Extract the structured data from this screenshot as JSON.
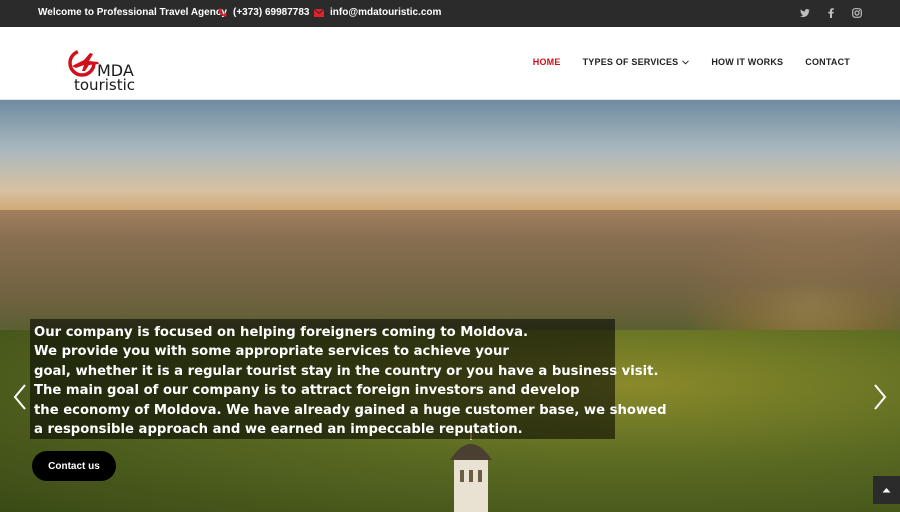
{
  "topbar": {
    "welcome": "Welcome to Professional Travel Agency",
    "phone": "(+373) 69987783",
    "email": "info@mdatouristic.com",
    "social": [
      "twitter-icon",
      "facebook-icon",
      "instagram-icon"
    ]
  },
  "brand": {
    "name_line1": "MDA",
    "name_line2": "touristic",
    "accent_color": "#d0101a"
  },
  "nav": {
    "home": "HOME",
    "services": "TYPES OF SERVICES",
    "how": "HOW IT WORKS",
    "contact": "CONTACT"
  },
  "hero": {
    "lines": [
      "Our company is focused on helping foreigners coming to Moldova.",
      "We provide you with some appropriate services to achieve your",
      "goal, whether it is a regular tourist stay in the country or you have a business visit.",
      "The main goal of our company is to attract foreign investors and develop",
      "the economy of Moldova. We have already gained a huge customer base, we showed",
      "a responsible approach and we earned an impeccable reputation."
    ],
    "cta": "Contact us"
  }
}
